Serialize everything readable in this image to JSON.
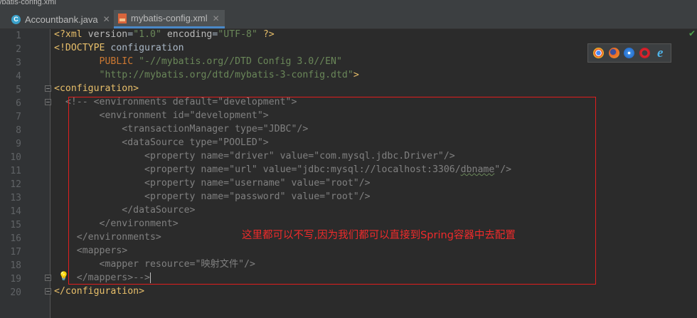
{
  "window": {
    "title": "ybatis-config.xml"
  },
  "tabs": [
    {
      "label": "Accountbank.java",
      "icon": "java-class-icon",
      "active": false
    },
    {
      "label": "mybatis-config.xml",
      "icon": "xml-file-icon",
      "active": true
    }
  ],
  "line_numbers": [
    "1",
    "2",
    "3",
    "4",
    "5",
    "6",
    "7",
    "8",
    "9",
    "10",
    "11",
    "12",
    "13",
    "14",
    "15",
    "16",
    "17",
    "18",
    "19",
    "20"
  ],
  "code": {
    "l1": {
      "a": "<?",
      "b": "xml ",
      "c": "version",
      "d": "=",
      "e": "\"1.0\"",
      "f": " ",
      "g": "encoding",
      "h": "=",
      "i": "\"UTF-8\"",
      "j": " ?>"
    },
    "l2": {
      "a": "<!DOCTYPE ",
      "b": "configuration"
    },
    "l3": {
      "a": "        PUBLIC ",
      "b": "\"-//mybatis.org//DTD Config 3.0//EN\""
    },
    "l4": {
      "a": "        ",
      "b": "\"http://mybatis.org/dtd/mybatis-3-config.dtd\"",
      "c": ">"
    },
    "l5": {
      "a": "<configuration>"
    },
    "l6": {
      "a": "  <!-- <environments default=\"development\">"
    },
    "l7": {
      "a": "        <environment id=\"development\">"
    },
    "l8": {
      "a": "            <transactionManager type=\"JDBC\"/>"
    },
    "l9": {
      "a": "            <dataSource type=\"POOLED\">"
    },
    "l10": {
      "a": "                <property name=\"driver\" value=\"com.mysql.jdbc.Driver\"/>"
    },
    "l11": {
      "a": "                <property name=\"url\" value=\"jdbc:mysql://localhost:3306/",
      "b": "dbname",
      "c": "\"/>"
    },
    "l12": {
      "a": "                <property name=\"username\" value=\"root\"/>"
    },
    "l13": {
      "a": "                <property name=\"password\" value=\"root\"/>"
    },
    "l14": {
      "a": "            </dataSource>"
    },
    "l15": {
      "a": "        </environment>"
    },
    "l16": {
      "a": "    </environments>"
    },
    "l17": {
      "a": "    <mappers>"
    },
    "l18": {
      "a": "        <mapper resource=\"映射文件\"/>"
    },
    "l19": {
      "a": "    </mappers>-->"
    },
    "l20": {
      "a": "</configuration>"
    }
  },
  "annotation": {
    "text": "这里都可以不写,因为我们都可以直接到Spring容器中去配置",
    "color": "#e01e1e"
  },
  "browser_icons": [
    "chrome-icon",
    "firefox-icon",
    "safari-icon",
    "opera-icon",
    "ie-icon"
  ],
  "colors": {
    "tag": "#e8bf6a",
    "string": "#6a8759",
    "comment": "#808080",
    "keyword": "#cc7832"
  }
}
